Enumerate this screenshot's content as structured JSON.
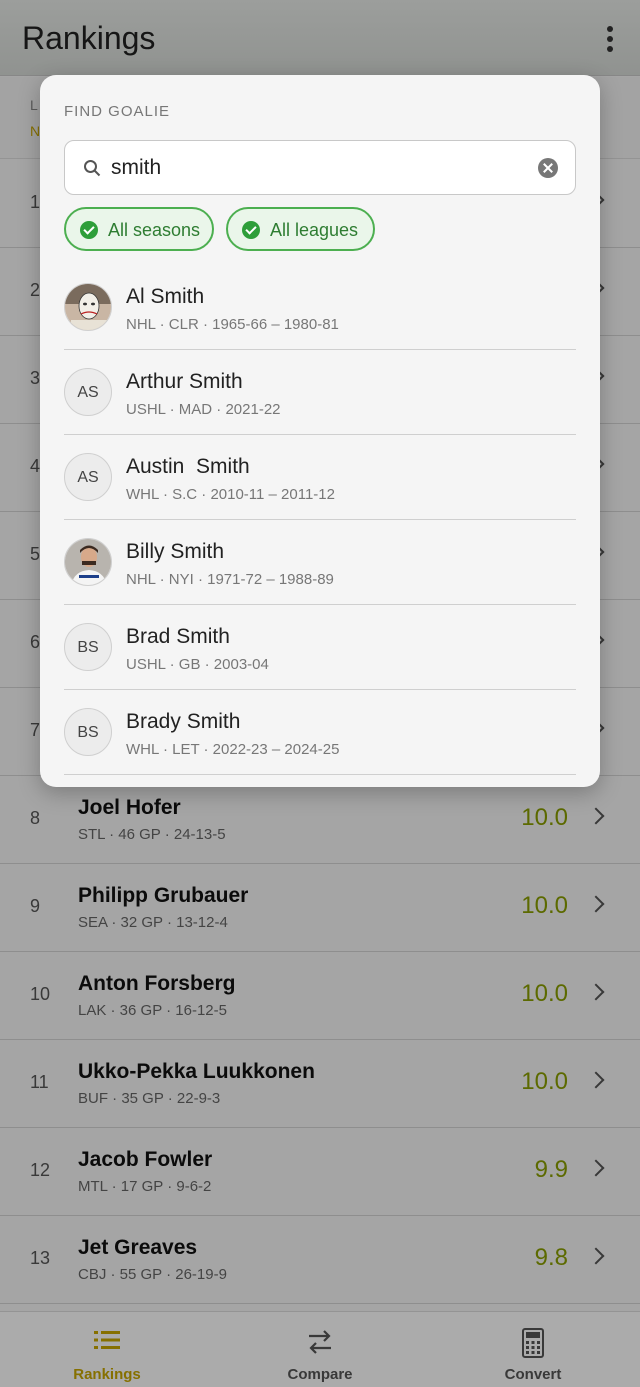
{
  "appbar": {
    "title": "Rankings"
  },
  "subheader": {
    "line1": "L",
    "line2": "N"
  },
  "rankings": [
    {
      "rank": "1",
      "name": "",
      "sub": "",
      "score": ""
    },
    {
      "rank": "2",
      "name": "",
      "sub": "",
      "score": ""
    },
    {
      "rank": "3",
      "name": "",
      "sub": "",
      "score": ""
    },
    {
      "rank": "4",
      "name": "",
      "sub": "",
      "score": ""
    },
    {
      "rank": "5",
      "name": "",
      "sub": "",
      "score": ""
    },
    {
      "rank": "6",
      "name": "",
      "sub": "",
      "score": ""
    },
    {
      "rank": "7",
      "name": "",
      "sub": "",
      "score": ""
    },
    {
      "rank": "8",
      "name": "Joel Hofer",
      "sub": "STL · 46 GP · 24-13-5",
      "score": "10.0"
    },
    {
      "rank": "9",
      "name": "Philipp Grubauer",
      "sub": "SEA · 32 GP · 13-12-4",
      "score": "10.0"
    },
    {
      "rank": "10",
      "name": "Anton Forsberg",
      "sub": "LAK · 36 GP · 16-12-5",
      "score": "10.0"
    },
    {
      "rank": "11",
      "name": "Ukko-Pekka Luukkonen",
      "sub": "BUF · 35 GP · 22-9-3",
      "score": "10.0"
    },
    {
      "rank": "12",
      "name": "Jacob Fowler",
      "sub": "MTL · 17 GP · 9-6-2",
      "score": "9.9"
    },
    {
      "rank": "13",
      "name": "Jet Greaves",
      "sub": "CBJ · 55 GP · 26-19-9",
      "score": "9.8"
    }
  ],
  "nav": {
    "rankings": "Rankings",
    "compare": "Compare",
    "convert": "Convert"
  },
  "dialog": {
    "title": "FIND GOALIE",
    "search_value": "smith",
    "chips": [
      "All seasons",
      "All leagues"
    ],
    "results": [
      {
        "name": "Al Smith",
        "sub": "NHL · CLR · 1965-66 – 1980-81",
        "initials": "",
        "photo": true
      },
      {
        "name": "Arthur Smith",
        "sub": "USHL · MAD · 2021-22",
        "initials": "AS",
        "photo": false
      },
      {
        "name": "Austin  Smith",
        "sub": "WHL · S.C · 2010-11 – 2011-12",
        "initials": "AS",
        "photo": false
      },
      {
        "name": "Billy Smith",
        "sub": "NHL · NYI · 1971-72 – 1988-89",
        "initials": "",
        "photo": true
      },
      {
        "name": "Brad Smith",
        "sub": "USHL · GB · 2003-04",
        "initials": "BS",
        "photo": false
      },
      {
        "name": "Brady Smith",
        "sub": "WHL · LET · 2022-23 – 2024-25",
        "initials": "BS",
        "photo": false
      }
    ]
  },
  "colors": {
    "accent": "#c8a700",
    "score": "#8a9e00",
    "chip": "#4caf50"
  }
}
